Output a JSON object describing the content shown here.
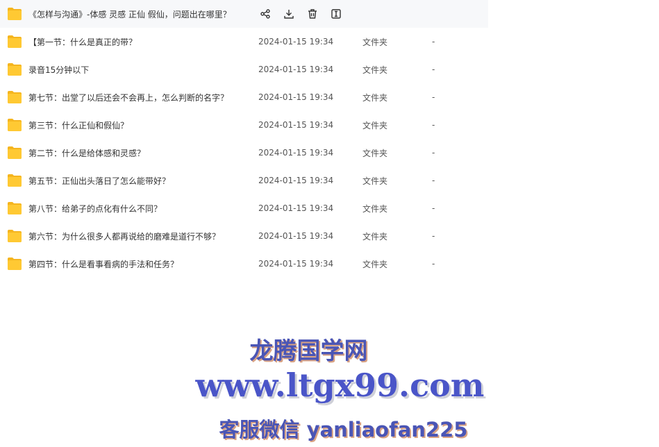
{
  "selected_row": {
    "name": "《怎样与沟通》-体感 灵感 正仙 假仙，问题出在哪里？",
    "actions": [
      {
        "icon": "share-icon",
        "name": "share-button"
      },
      {
        "icon": "download-icon",
        "name": "download-button"
      },
      {
        "icon": "trash-icon",
        "name": "delete-button"
      },
      {
        "icon": "rename-icon",
        "name": "rename-button"
      }
    ]
  },
  "rows": [
    {
      "name": "【第一节：什么是真正的带？",
      "date": "2024-01-15 19:34",
      "type": "文件夹",
      "size": "-"
    },
    {
      "name": "录音15分钟以下",
      "date": "2024-01-15 19:34",
      "type": "文件夹",
      "size": "-"
    },
    {
      "name": "第七节：出堂了以后还会不会再上，怎么判断的名字？",
      "date": "2024-01-15 19:34",
      "type": "文件夹",
      "size": "-"
    },
    {
      "name": "第三节：什么正仙和假仙？",
      "date": "2024-01-15 19:34",
      "type": "文件夹",
      "size": "-"
    },
    {
      "name": "第二节：什么是给体感和灵感？",
      "date": "2024-01-15 19:34",
      "type": "文件夹",
      "size": "-"
    },
    {
      "name": "第五节：正仙出头落日了怎么能带好？",
      "date": "2024-01-15 19:34",
      "type": "文件夹",
      "size": "-"
    },
    {
      "name": "第八节：给弟子的点化有什么不同？",
      "date": "2024-01-15 19:34",
      "type": "文件夹",
      "size": "-"
    },
    {
      "name": "第六节：为什么很多人都再说给的磨难是道行不够？",
      "date": "2024-01-15 19:34",
      "type": "文件夹",
      "size": "-"
    },
    {
      "name": "第四节：什么是看事看病的手法和任务？",
      "date": "2024-01-15 19:34",
      "type": "文件夹",
      "size": "-"
    }
  ],
  "watermark": {
    "line1": "龙腾国学网",
    "line2": "www.ltgx99.com",
    "line3": "客服微信 yanliaofan225"
  },
  "colors": {
    "folder": "#ffc933",
    "folder_tab": "#f5b51f",
    "watermark_blue": "#4a55b5"
  }
}
